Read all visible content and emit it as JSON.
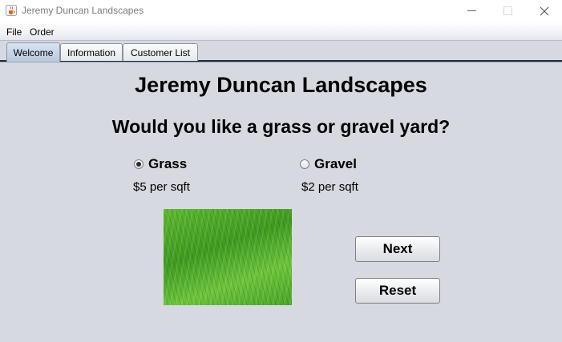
{
  "window": {
    "title": "Jeremy Duncan Landscapes",
    "icon": "java-cup-icon"
  },
  "menubar": {
    "items": [
      "File",
      "Order"
    ]
  },
  "tabs": [
    {
      "label": "Welcome",
      "selected": true
    },
    {
      "label": "Information",
      "selected": false
    },
    {
      "label": "Customer List",
      "selected": false
    }
  ],
  "main": {
    "company_name": "Jeremy Duncan Landscapes",
    "question": "Would you like a grass or gravel yard?",
    "options": [
      {
        "label": "Grass",
        "price": "$5 per sqft",
        "selected": true
      },
      {
        "label": "Gravel",
        "price": "$2 per sqft",
        "selected": false
      }
    ],
    "image": "grass-texture-image",
    "buttons": {
      "next": "Next",
      "reset": "Reset"
    }
  }
}
